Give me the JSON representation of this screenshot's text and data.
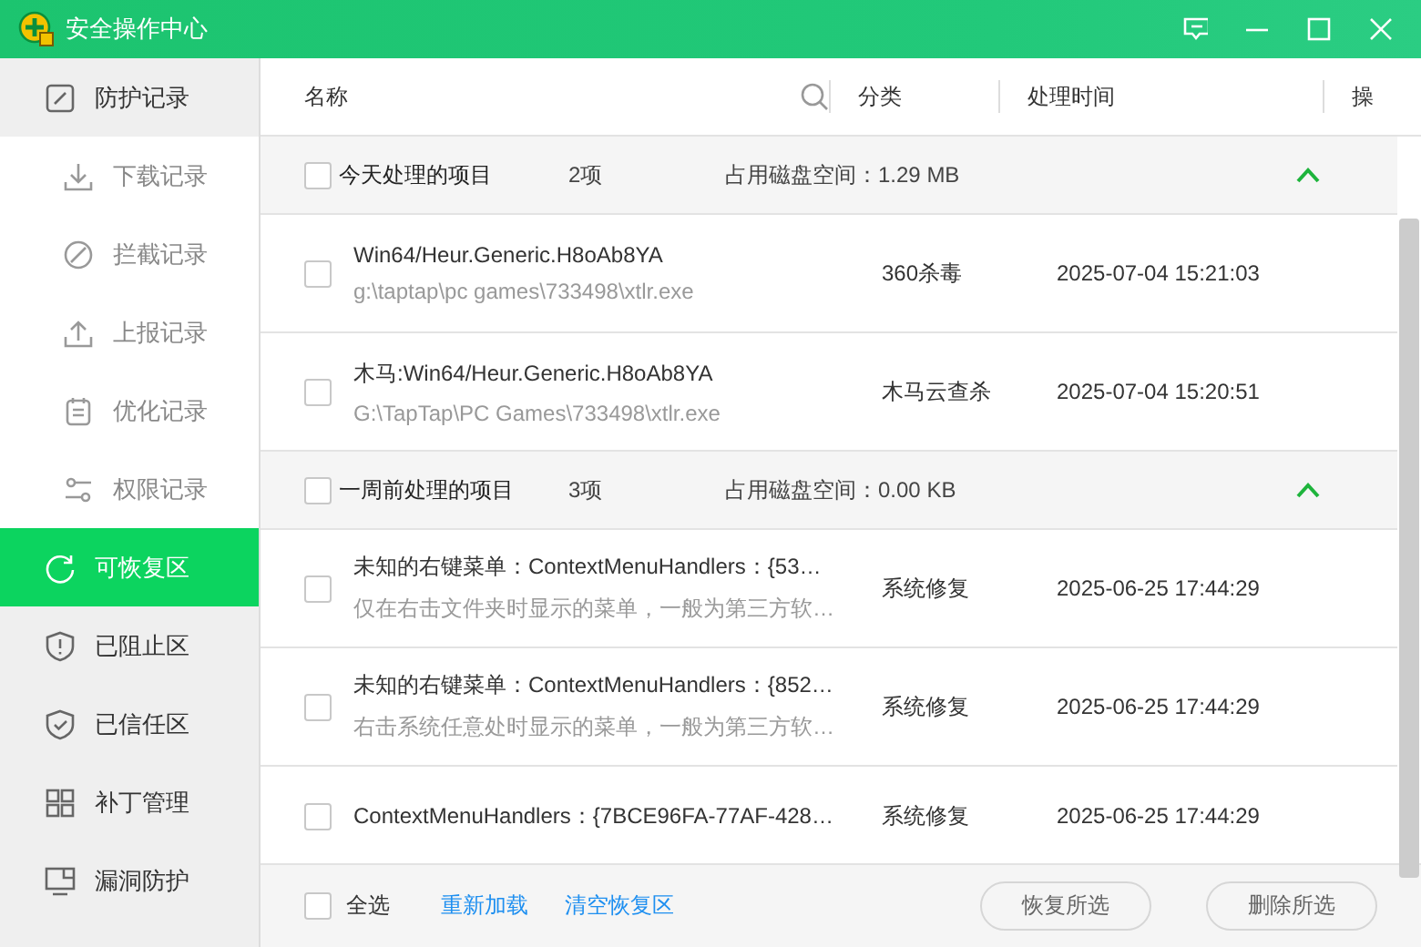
{
  "window": {
    "title": "安全操作中心"
  },
  "sidebar": {
    "items": [
      {
        "label": "防护记录",
        "kind": "section",
        "selected": false
      },
      {
        "label": "下载记录",
        "kind": "sub",
        "selected": false
      },
      {
        "label": "拦截记录",
        "kind": "sub",
        "selected": false
      },
      {
        "label": "上报记录",
        "kind": "sub",
        "selected": false
      },
      {
        "label": "优化记录",
        "kind": "sub",
        "selected": false
      },
      {
        "label": "权限记录",
        "kind": "sub",
        "selected": false
      },
      {
        "label": "可恢复区",
        "kind": "section",
        "selected": true
      },
      {
        "label": "已阻止区",
        "kind": "section",
        "selected": false
      },
      {
        "label": "已信任区",
        "kind": "section",
        "selected": false
      },
      {
        "label": "补丁管理",
        "kind": "section",
        "selected": false
      },
      {
        "label": "漏洞防护",
        "kind": "section",
        "selected": false
      }
    ]
  },
  "table": {
    "columns": [
      "名称",
      "分类",
      "处理时间",
      "操"
    ],
    "groups": [
      {
        "title": "今天处理的项目",
        "checked": false,
        "count": "2项",
        "disk_usage": "占用磁盘空间：1.29 MB",
        "expanded": true,
        "rows": [
          {
            "checked": false,
            "name": "Win64/Heur.Generic.H8oAb8YA",
            "detail": "g:\\taptap\\pc games\\733498\\xtlr.exe",
            "category": "360杀毒",
            "time": "2025-07-04 15:21:03"
          },
          {
            "checked": false,
            "name": "木马:Win64/Heur.Generic.H8oAb8YA",
            "detail": "G:\\TapTap\\PC Games\\733498\\xtlr.exe",
            "category": "木马云查杀",
            "time": "2025-07-04 15:20:51"
          }
        ]
      },
      {
        "title": "一周前处理的项目",
        "checked": false,
        "count": "3项",
        "disk_usage": "占用磁盘空间：0.00 KB",
        "expanded": true,
        "rows": [
          {
            "checked": false,
            "name": "未知的右键菜单：ContextMenuHandlers：{53…",
            "detail": "仅在右击文件夹时显示的菜单，一般为第三方软…",
            "category": "系统修复",
            "time": "2025-06-25 17:44:29"
          },
          {
            "checked": false,
            "name": "未知的右键菜单：ContextMenuHandlers：{852…",
            "detail": "右击系统任意处时显示的菜单，一般为第三方软…",
            "category": "系统修复",
            "time": "2025-06-25 17:44:29"
          },
          {
            "checked": false,
            "name": "ContextMenuHandlers：{7BCE96FA-77AF-428…",
            "category": "系统修复",
            "time": "2025-06-25 17:44:29"
          }
        ]
      }
    ]
  },
  "footer": {
    "select_all": {
      "label": "全选",
      "checked": false
    },
    "links": [
      "重新加载",
      "清空恢复区"
    ],
    "buttons": [
      "恢复所选",
      "删除所选"
    ]
  }
}
